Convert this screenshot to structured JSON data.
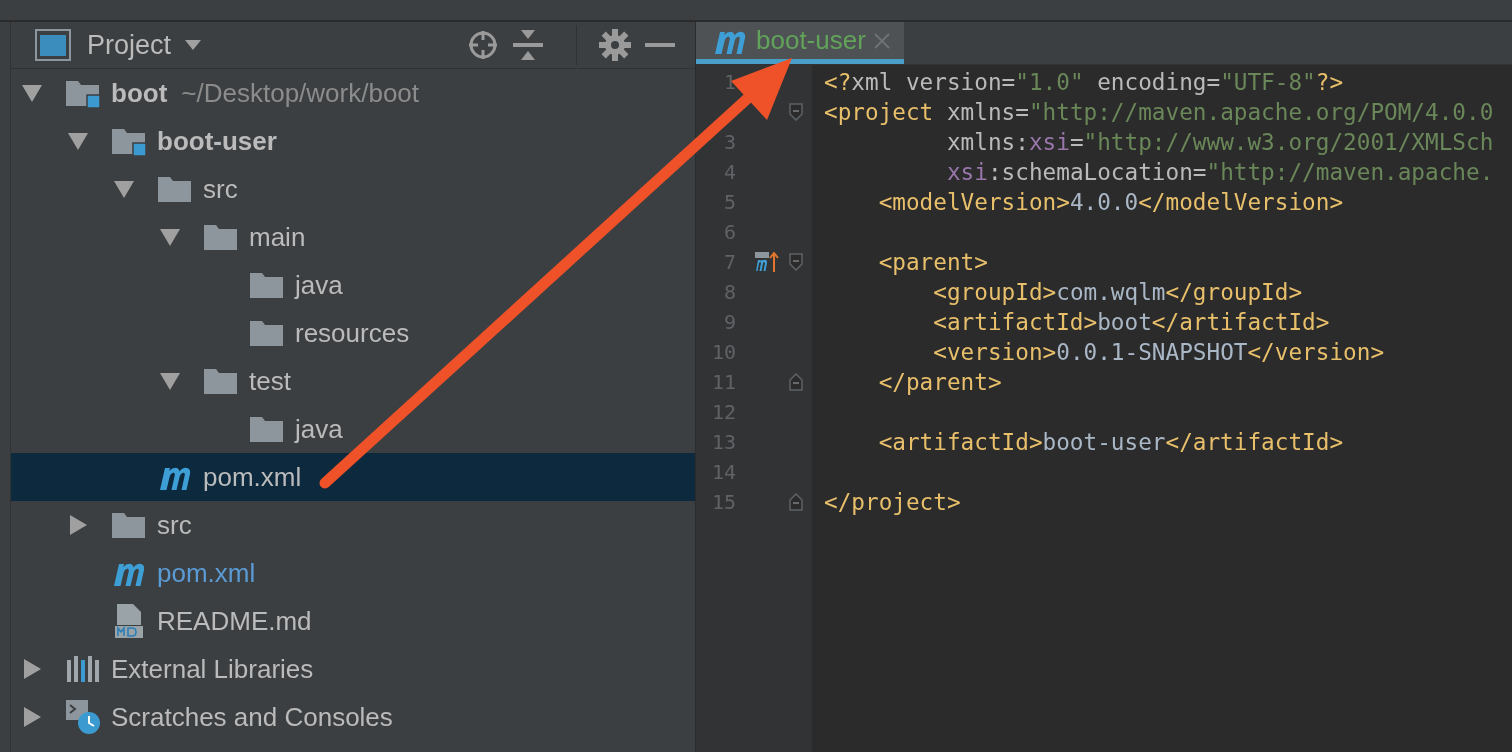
{
  "project_panel": {
    "title": "Project",
    "tree": [
      {
        "kind": "module",
        "name": "boot",
        "path": "~/Desktop/work/boot",
        "expanded": true,
        "selected": false,
        "modified": false,
        "children": [
          {
            "kind": "module",
            "name": "boot-user",
            "expanded": true,
            "selected": false,
            "modified": false,
            "children": [
              {
                "kind": "folder",
                "name": "src",
                "expanded": true,
                "selected": false,
                "modified": false,
                "children": [
                  {
                    "kind": "folder",
                    "name": "main",
                    "expanded": true,
                    "selected": false,
                    "modified": false,
                    "children": [
                      {
                        "kind": "folder",
                        "name": "java",
                        "selected": false,
                        "modified": false
                      },
                      {
                        "kind": "folder",
                        "name": "resources",
                        "selected": false,
                        "modified": false
                      }
                    ]
                  },
                  {
                    "kind": "folder",
                    "name": "test",
                    "expanded": true,
                    "selected": false,
                    "modified": false,
                    "children": [
                      {
                        "kind": "folder",
                        "name": "java",
                        "selected": false,
                        "modified": false
                      }
                    ]
                  }
                ]
              },
              {
                "kind": "maven",
                "name": "pom.xml",
                "selected": true,
                "modified": false
              }
            ]
          },
          {
            "kind": "folder",
            "name": "src",
            "expanded": false,
            "selected": false,
            "modified": false
          },
          {
            "kind": "maven",
            "name": "pom.xml",
            "selected": false,
            "modified": true
          },
          {
            "kind": "markdown",
            "name": "README.md",
            "selected": false,
            "modified": false
          }
        ]
      },
      {
        "kind": "libraries",
        "name": "External Libraries",
        "expanded": false,
        "selected": false,
        "modified": false
      },
      {
        "kind": "scratches",
        "name": "Scratches and Consoles",
        "expanded": false,
        "selected": false,
        "modified": false
      }
    ]
  },
  "editor": {
    "tabs": [
      {
        "label": "boot-user",
        "selected": true
      }
    ],
    "lines": [
      {
        "number": "1",
        "fold_start": false,
        "fold_end": false,
        "marker": false,
        "tokens": [
          {
            "kind": "tag",
            "text": "<?"
          },
          {
            "kind": "attr",
            "text": "xml version="
          },
          {
            "kind": "str",
            "text": "\"1.0\""
          },
          {
            "kind": "attr",
            "text": " encoding="
          },
          {
            "kind": "str",
            "text": "\"UTF-8\""
          },
          {
            "kind": "tag",
            "text": "?>"
          }
        ]
      },
      {
        "fold_start": true,
        "fold_end": false,
        "marker": false,
        "tokens": [
          {
            "kind": "tag",
            "text": "<project"
          },
          {
            "kind": "attr",
            "text": " xmlns="
          },
          {
            "kind": "str",
            "text": "\"http://maven.apache.org/POM/4.0.0"
          }
        ]
      },
      {
        "number": "3",
        "fold_start": false,
        "fold_end": false,
        "marker": false,
        "tokens": [
          {
            "kind": "attr",
            "text": "         xmlns:"
          },
          {
            "kind": "ns",
            "text": "xsi"
          },
          {
            "kind": "attr",
            "text": "="
          },
          {
            "kind": "str",
            "text": "\"http://www.w3.org/2001/XMLSch"
          }
        ]
      },
      {
        "number": "4",
        "fold_start": false,
        "fold_end": false,
        "marker": false,
        "tokens": [
          {
            "kind": "ns",
            "text": "         xsi"
          },
          {
            "kind": "attr",
            "text": ":schemaLocation="
          },
          {
            "kind": "str",
            "text": "\"http://maven.apache."
          }
        ]
      },
      {
        "number": "5",
        "fold_start": false,
        "fold_end": false,
        "marker": false,
        "tokens": [
          {
            "kind": "tag",
            "text": "    <modelVersion>"
          },
          {
            "kind": "text",
            "text": "4.0.0"
          },
          {
            "kind": "tag",
            "text": "</modelVersion>"
          }
        ]
      },
      {
        "number": "6",
        "fold_start": false,
        "fold_end": false,
        "marker": false
      },
      {
        "number": "7",
        "fold_start": true,
        "fold_end": false,
        "marker": true,
        "tokens": [
          {
            "kind": "tag",
            "text": "    <parent>"
          }
        ]
      },
      {
        "number": "8",
        "fold_start": false,
        "fold_end": false,
        "marker": false,
        "tokens": [
          {
            "kind": "tag",
            "text": "        <groupId>"
          },
          {
            "kind": "text",
            "text": "com.wqlm"
          },
          {
            "kind": "tag",
            "text": "</groupId>"
          }
        ]
      },
      {
        "number": "9",
        "fold_start": false,
        "fold_end": false,
        "marker": false,
        "tokens": [
          {
            "kind": "tag",
            "text": "        <artifactId>"
          },
          {
            "kind": "text",
            "text": "boot"
          },
          {
            "kind": "tag",
            "text": "</artifactId>"
          }
        ]
      },
      {
        "number": "10",
        "fold_start": false,
        "fold_end": false,
        "marker": false,
        "tokens": [
          {
            "kind": "tag",
            "text": "        <version>"
          },
          {
            "kind": "text",
            "text": "0.0.1-SNAPSHOT"
          },
          {
            "kind": "tag",
            "text": "</version>"
          }
        ]
      },
      {
        "number": "11",
        "fold_start": false,
        "fold_end": true,
        "marker": false,
        "tokens": [
          {
            "kind": "tag",
            "text": "    </parent>"
          }
        ]
      },
      {
        "number": "12",
        "fold_start": false,
        "fold_end": false,
        "marker": false
      },
      {
        "number": "13",
        "fold_start": false,
        "fold_end": false,
        "marker": false,
        "tokens": [
          {
            "kind": "tag",
            "text": "    <artifactId>"
          },
          {
            "kind": "text",
            "text": "boot-user"
          },
          {
            "kind": "tag",
            "text": "</artifactId>"
          }
        ]
      },
      {
        "number": "14",
        "fold_start": false,
        "fold_end": false,
        "marker": false
      },
      {
        "number": "15",
        "fold_start": false,
        "fold_end": true,
        "marker": false,
        "tokens": [
          {
            "kind": "tag",
            "text": "</project>"
          }
        ]
      }
    ]
  }
}
